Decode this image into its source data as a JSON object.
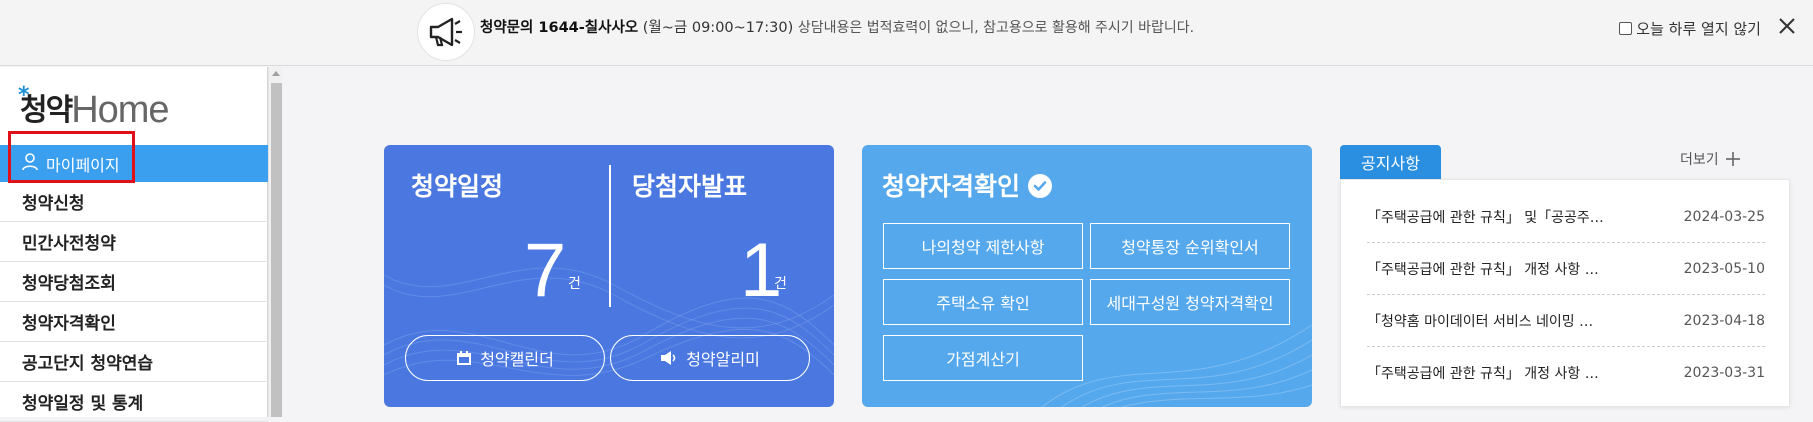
{
  "topbar": {
    "phone_label": "청약문의 1644-칠사사오",
    "hours": "(월~금 09:00~17:30)",
    "note": "상담내용은 법적효력이 없으니, 참고용으로 활용해 주시기 바랍니다.",
    "dont_show_label": "오늘 하루 열지 않기"
  },
  "sidebar": {
    "logo_ko": "청약",
    "logo_home": "Home",
    "items": [
      {
        "label": "마이페이지"
      },
      {
        "label": "청약신청"
      },
      {
        "label": "민간사전청약"
      },
      {
        "label": "청약당첨조회"
      },
      {
        "label": "청약자격확인"
      },
      {
        "label": "공고단지 청약연습"
      },
      {
        "label": "청약일정 및 통계"
      }
    ]
  },
  "schedule_card": {
    "title_left": "청약일정",
    "title_right": "당첨자발표",
    "count_left": "7",
    "count_right": "1",
    "unit": "건",
    "calendar_button": "청약캘린더",
    "alarm_button": "청약알리미"
  },
  "qualification_card": {
    "title": "청약자격확인",
    "buttons": [
      "나의청약 제한사항",
      "청약통장 순위확인서",
      "주택소유 확인",
      "세대구성원 청약자격확인",
      "가점계산기"
    ]
  },
  "notices": {
    "tab": "공지사항",
    "more": "더보기",
    "items": [
      {
        "title": "「주택공급에 관한 규칙」 및「공공주…",
        "date": "2024-03-25"
      },
      {
        "title": "「주택공급에 관한 규칙」 개정 사항 …",
        "date": "2023-05-10"
      },
      {
        "title": "「청약홈 마이데이터 서비스 네이밍 …",
        "date": "2023-04-18"
      },
      {
        "title": "「주택공급에 관한 규칙」 개정 사항 …",
        "date": "2023-03-31"
      }
    ]
  },
  "colors": {
    "accent_blue": "#3b9ff0",
    "card1": "#4a78e0",
    "card2": "#56a8ec",
    "notice_tab": "#2a8fe0",
    "highlight": "#e0101b"
  }
}
